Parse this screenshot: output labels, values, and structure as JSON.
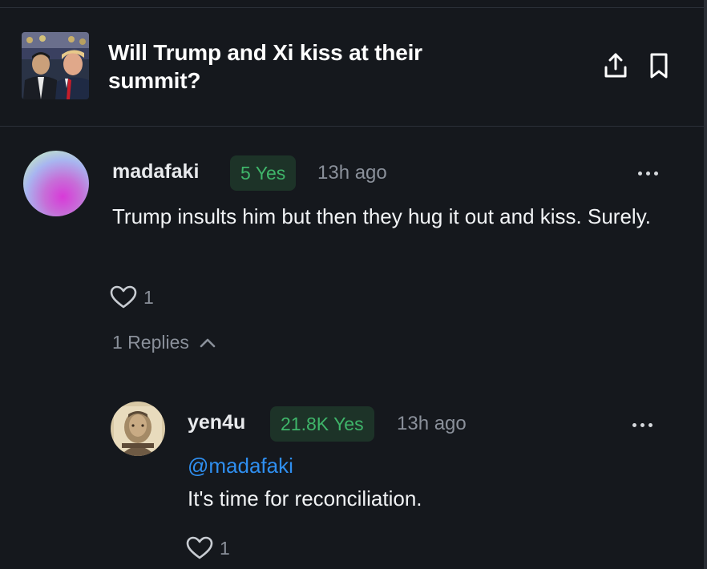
{
  "market": {
    "title": "Will Trump and Xi kiss at their summit?",
    "share_icon": "share-upload-icon",
    "bookmark_icon": "bookmark-icon"
  },
  "comments": [
    {
      "username": "madafaki",
      "position": "5 Yes",
      "time": "13h ago",
      "text": "Trump insults him but then they hug it out and kiss. Surely.",
      "likes": "1",
      "replies_label": "1 Replies"
    }
  ],
  "replies": [
    {
      "username": "yen4u",
      "position": "21.8K Yes",
      "time": "13h ago",
      "mention": "@madafaki",
      "text": "It's time for reconciliation.",
      "likes": "1"
    }
  ],
  "colors": {
    "background": "#15181d",
    "yes_green": "#3fb56a",
    "yes_badge_bg": "#1d3328",
    "mention_blue": "#2f8ff0",
    "muted": "#8a909a"
  }
}
